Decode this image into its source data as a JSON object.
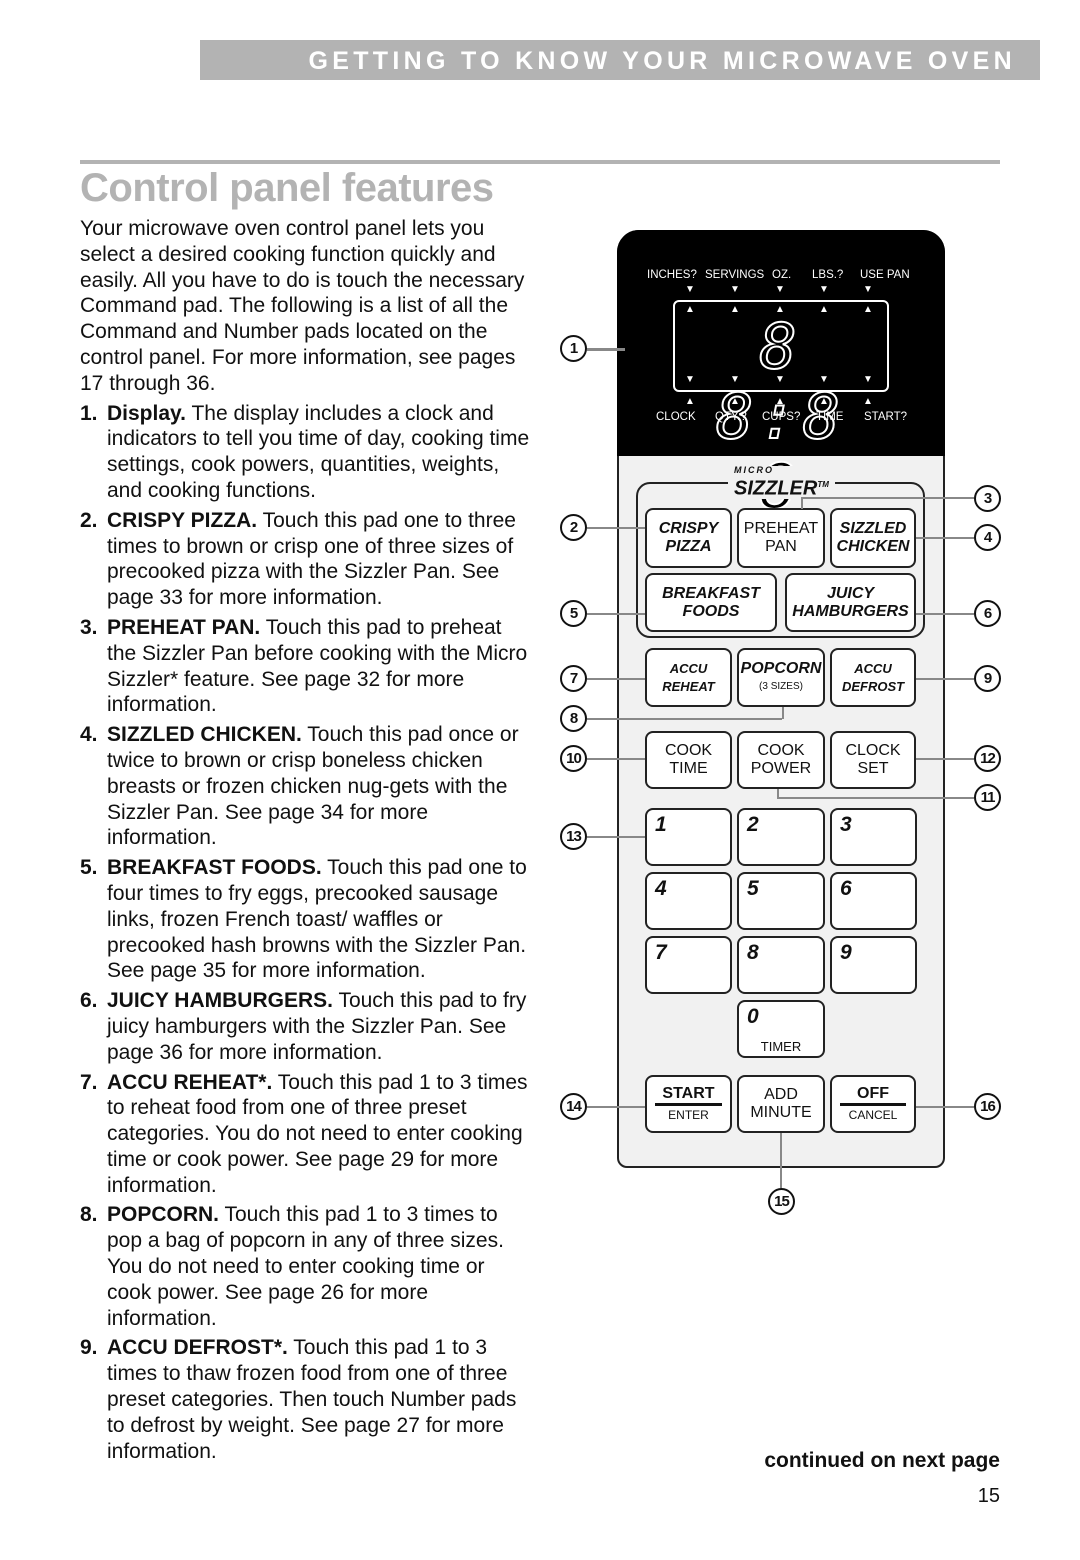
{
  "header": {
    "section": "GETTING TO KNOW YOUR MICROWAVE OVEN",
    "title": "Control panel features"
  },
  "intro": "Your microwave oven control panel lets you select a desired cooking function quickly and easily. All you have to do is touch the necessary Command pad. The following is a list of all the Command and Number pads located on the control panel. For more information, see pages 17 through 36.",
  "items": [
    {
      "num": "1.",
      "name": "Display.",
      "text": " The display includes a clock and indicators to tell you time of day, cooking time settings, cook powers, quantities, weights, and cooking functions."
    },
    {
      "num": "2.",
      "name": "CRISPY PIZZA.",
      "text": " Touch this pad one to three times to brown or crisp one of three sizes of precooked pizza with the Sizzler Pan. See page 33 for more information."
    },
    {
      "num": "3.",
      "name": "PREHEAT PAN.",
      "text": " Touch this pad to preheat the Sizzler Pan before cooking with the Micro Sizzler* feature. See page 32 for more information."
    },
    {
      "num": "4.",
      "name": "SIZZLED CHICKEN.",
      "text": " Touch this pad once or twice to brown or crisp boneless chicken breasts or frozen chicken nug-gets with the Sizzler Pan. See page 34 for more information."
    },
    {
      "num": "5.",
      "name": "BREAKFAST FOODS.",
      "text": " Touch this pad one to four times to fry eggs, precooked sausage links, frozen French toast/ waffles or precooked hash browns with the Sizzler Pan. See page 35 for more information."
    },
    {
      "num": "6.",
      "name": "JUICY HAMBURGERS.",
      "text": " Touch this pad to fry juicy hamburgers with the Sizzler Pan. See page 36 for more information."
    },
    {
      "num": "7.",
      "name": "ACCU REHEAT*.",
      "text": " Touch this pad 1 to 3 times to reheat food from one of three preset categories. You do not need to enter cooking time or cook power. See page 29 for more information."
    },
    {
      "num": "8.",
      "name": "POPCORN.",
      "text": " Touch this pad 1 to 3 times to pop a bag of popcorn in any of three sizes. You do not need to enter cooking time or cook power. See page 26 for more information."
    },
    {
      "num": "9.",
      "name": "ACCU DEFROST*.",
      "text": " Touch this pad 1 to 3 times to thaw frozen food from one of three preset categories. Then touch Number pads to defrost by weight. See page 27 for more information."
    }
  ],
  "display": {
    "top_labels": [
      "INCHES?",
      "SERVINGS",
      "OZ.",
      "LBS.?",
      "USE PAN"
    ],
    "bottom_labels": [
      "CLOCK",
      "QTY.?",
      "CUPS?",
      "TIME",
      "START?"
    ],
    "digits": "8 8:8 8"
  },
  "logo": {
    "small": "MICRO",
    "big": "SIZZLER",
    "tm": "TM"
  },
  "pads": [
    {
      "id": "crispy-pizza",
      "l1": "CRISPY",
      "l2": "PIZZA",
      "it": true
    },
    {
      "id": "preheat-pan",
      "l1": "PREHEAT",
      "l2": "PAN",
      "it": false
    },
    {
      "id": "sizzled-chicken",
      "l1": "SIZZLED",
      "l2": "CHICKEN",
      "it": true
    },
    {
      "id": "breakfast-foods",
      "l1": "BREAKFAST",
      "l2": "FOODS",
      "it": true
    },
    {
      "id": "juicy-hamburgers",
      "l1": "JUICY",
      "l2": "HAMBURGERS",
      "it": true
    },
    {
      "id": "accu-reheat",
      "l1": "ACCU",
      "l2": "REHEAT",
      "it": true
    },
    {
      "id": "popcorn",
      "l1": "POPCORN",
      "l2": "(3 SIZES)",
      "it": true
    },
    {
      "id": "accu-defrost",
      "l1": "ACCU",
      "l2": "DEFROST",
      "it": true
    },
    {
      "id": "cook-time",
      "l1": "COOK",
      "l2": "TIME",
      "it": false
    },
    {
      "id": "cook-power",
      "l1": "COOK",
      "l2": "POWER",
      "it": false
    },
    {
      "id": "clock-set",
      "l1": "CLOCK",
      "l2": "SET",
      "it": false
    },
    {
      "id": "start-enter",
      "l1": "START",
      "l2": "ENTER",
      "it": false
    },
    {
      "id": "add-minute",
      "l1": "ADD",
      "l2": "MINUTE",
      "it": false
    },
    {
      "id": "off-cancel",
      "l1": "OFF",
      "l2": "CANCEL",
      "it": false
    }
  ],
  "numbers": [
    "1",
    "2",
    "3",
    "4",
    "5",
    "6",
    "7",
    "8",
    "9",
    "0"
  ],
  "timer_label": "TIMER",
  "callouts": [
    "1",
    "2",
    "3",
    "4",
    "5",
    "6",
    "7",
    "8",
    "9",
    "10",
    "11",
    "12",
    "13",
    "14",
    "15",
    "16"
  ],
  "footer": {
    "continued": "continued on next page",
    "page": "15"
  }
}
